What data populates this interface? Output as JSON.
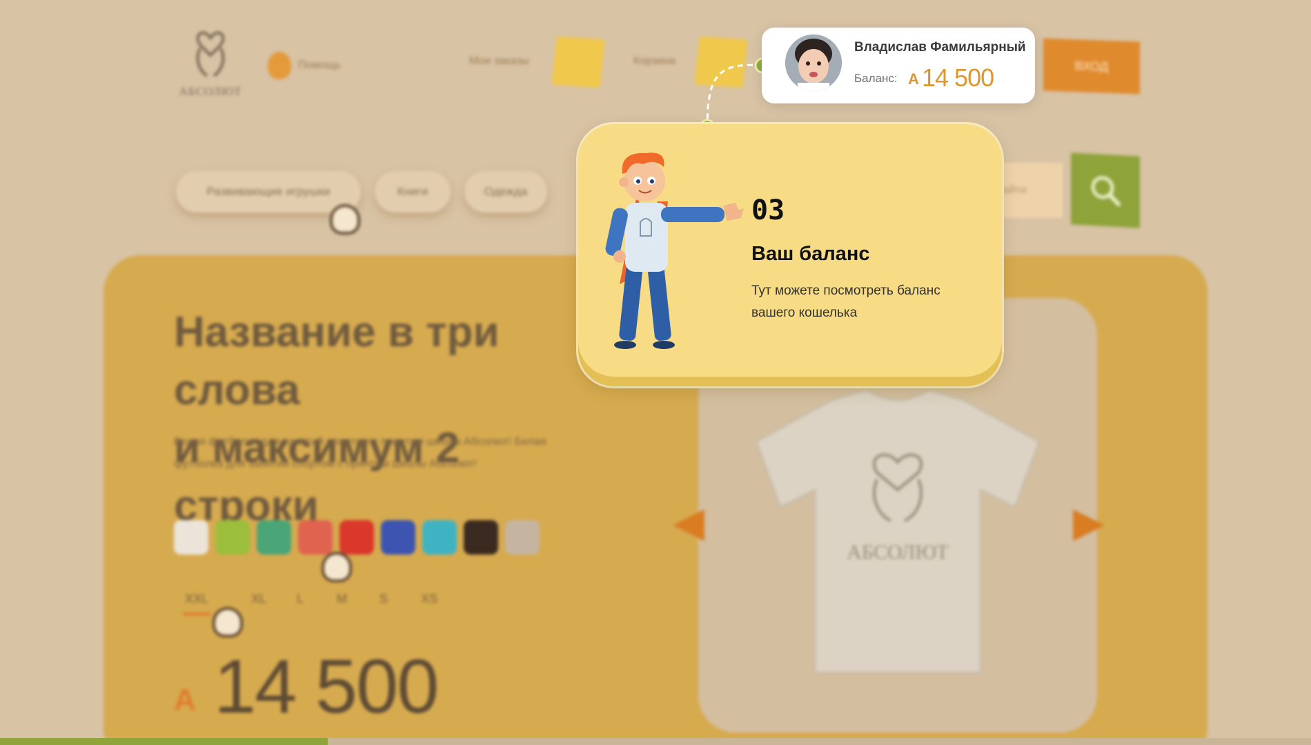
{
  "header": {
    "logo_text": "АБСОЛЮТ",
    "help_label": "Помощь",
    "nav": {
      "orders_label": "Мои заказы",
      "cart_label": "Корзина"
    },
    "login_label": "ВХОД"
  },
  "categories": [
    "Развивающие игрушки",
    "Книги",
    "Одежда"
  ],
  "search": {
    "placeholder": "Найти"
  },
  "product": {
    "title_line1": "Название в три слова",
    "title_line2": "и максимум 2 строки",
    "description": "Белая футболка для занятий спортом с принтом школы Абсолют! Белая футболка для занятий спортом с принтом школы Абсолют!",
    "colors": [
      "#ece4d8",
      "#9bbf3c",
      "#4aa577",
      "#e0634f",
      "#d9382a",
      "#3d55b0",
      "#3fb3c2",
      "#3b2a1f",
      "#c5b5a0"
    ],
    "sizes": [
      "XXL",
      "XL",
      "L",
      "M",
      "S",
      "XS"
    ],
    "selected_size": "XXL",
    "currency_symbol": "A",
    "price": "14 500",
    "image_logo_text": "АБСОЛЮТ"
  },
  "user": {
    "name": "Владислав Фамильярный",
    "balance_label": "Баланс:",
    "currency_symbol": "A",
    "balance": "14 500"
  },
  "tooltip": {
    "step": "03",
    "title": "Ваш баланс",
    "text": "Тут можете посмотреть баланс вашего кошелька"
  },
  "progress": {
    "fraction": 0.25
  },
  "colors": {
    "accent_green": "#8fa43a",
    "accent_orange": "#e0962e",
    "tooltip_bg": "#f7dc85"
  }
}
